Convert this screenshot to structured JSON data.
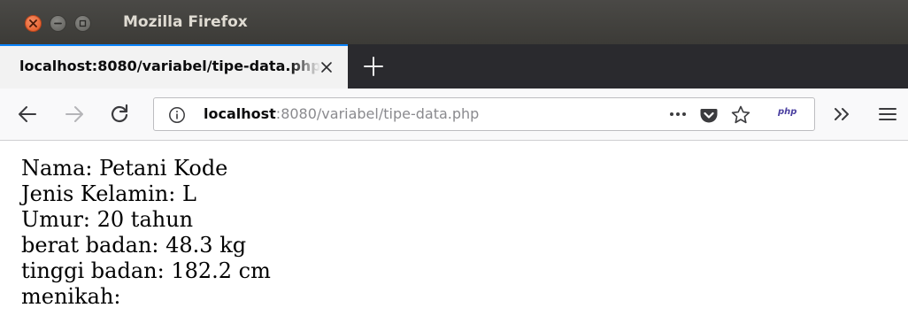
{
  "window": {
    "title": "Mozilla Firefox"
  },
  "tabs": [
    {
      "label": "localhost:8080/variabel/tipe-data.php",
      "active": true
    }
  ],
  "urlbar": {
    "host": "localhost",
    "rest": ":8080/variabel/tipe-data.php"
  },
  "toolbar_icons": {
    "php_badge": "php"
  },
  "page": {
    "lines": [
      "Nama: Petani Kode",
      "Jenis Kelamin: L",
      "Umur: 20 tahun",
      "berat badan: 48.3 kg",
      "tinggi badan: 182.2 cm",
      "menikah:"
    ]
  },
  "colors": {
    "titlebar": "#3c3b37",
    "close_button": "#e0541f",
    "tabstrip": "#2a2a2e",
    "active_tab_accent": "#0a84ff",
    "toolbar": "#f9f9fa"
  }
}
